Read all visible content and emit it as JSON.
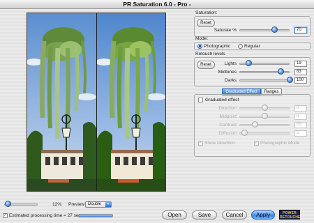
{
  "window": {
    "title": "PR Saturation 6.0  - Pro -"
  },
  "saturation": {
    "section_label": "Saturation:",
    "reset_label": "Reset",
    "slider_label": "Saturate %",
    "value": "70",
    "slider_fraction": 0.7
  },
  "mode": {
    "section_label": "Mode:",
    "options": [
      "Photographic",
      "Regular"
    ],
    "selected": "Photographic"
  },
  "retouch": {
    "section_label": "Retouch levels",
    "reset_label": "Reset",
    "lights": {
      "label": "Lights",
      "value": "19",
      "fraction": 0.19
    },
    "midtones": {
      "label": "Midtones",
      "value": "83",
      "fraction": 0.83
    },
    "darks": {
      "label": "Darks",
      "value": "100",
      "fraction": 1.0
    }
  },
  "tabs": [
    "Graduated Effect",
    "Ranges"
  ],
  "active_tab": "Graduated Effect",
  "graduated": {
    "checkbox_label": "Graduated effect",
    "enabled": false,
    "direction": {
      "label": "Direction",
      "value": "0"
    },
    "midpoint": {
      "label": "Midpoint",
      "value": "0"
    },
    "contrast": {
      "label": "Contrast",
      "value": "25"
    },
    "diffusion": {
      "label": "Diffusion",
      "value": "5"
    },
    "show_direction_label": "Show Direction",
    "show_direction_checked": true,
    "photographic_mode_label": "Photographic Mode",
    "photographic_mode_checked": true
  },
  "zoom": {
    "value": "12%",
    "fraction": 0.12
  },
  "preview": {
    "label": "Preview",
    "selected": "Double"
  },
  "estimate": {
    "checked": true,
    "label": "Estimated processing time = 27 sec.",
    "progress_fraction": 1.0
  },
  "buttons": {
    "open": "Open",
    "save": "Save",
    "cancel": "Cancel",
    "apply": "Apply"
  },
  "logo": {
    "line1": "POWER",
    "line2": "RETOUCHE"
  },
  "colors": {
    "accent": "#3b8ae4",
    "active_tab": "#2f79d4"
  }
}
